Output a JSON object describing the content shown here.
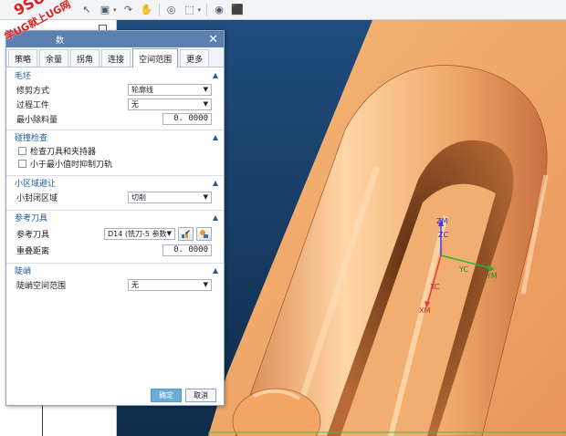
{
  "watermark": {
    "line1": "9SUG",
    "line2": "学UG就上UG网"
  },
  "toolbar": {
    "icons": [
      "cursor-icon",
      "snap-icon",
      "rotate-icon",
      "pan-icon",
      "target-icon",
      "select-box-icon",
      "view-icon",
      "cube-icon"
    ]
  },
  "dialog": {
    "title": "数",
    "close_glyph": "✕",
    "tabs": [
      "策略",
      "余量",
      "拐角",
      "连接",
      "空间范围",
      "更多"
    ],
    "active_tab": "空间范围",
    "sections": {
      "blank": {
        "title": "毛坯",
        "trim_method_label": "修剪方式",
        "trim_method_value": "轮廓线",
        "ipw_label": "过程工件",
        "ipw_value": "无",
        "min_removal_label": "最小除料量",
        "min_removal_value": "0. 0000"
      },
      "collision": {
        "title": "碰撞检查",
        "check_holder_label": "检查刀具和夹持器",
        "check_holder_checked": false,
        "suppress_label": "小于最小值时抑制刀轨",
        "suppress_checked": false
      },
      "small_area": {
        "title": "小区域避让",
        "closed_label": "小封闭区域",
        "closed_value": "切削"
      },
      "ref_tool": {
        "title": "参考刀具",
        "tool_label": "参考刀具",
        "tool_value": "D14 (铣刀-5 参数",
        "overlap_label": "重叠距离",
        "overlap_value": "0. 0000"
      },
      "steep": {
        "title": "陡峭",
        "range_label": "陡峭空间范围",
        "range_value": "无"
      }
    },
    "ok_label": "确定",
    "cancel_label": "取消"
  },
  "viewport": {
    "axes": {
      "zm": "ZM",
      "zc": "ZC",
      "yc": "YC",
      "ym": "YM",
      "xc": "XC",
      "xm": "XM"
    },
    "colors": {
      "part": "#f0a868",
      "background": "#15395f",
      "x_axis": "#e04040",
      "y_axis": "#2db02d",
      "z_axis": "#3a3aff"
    }
  }
}
